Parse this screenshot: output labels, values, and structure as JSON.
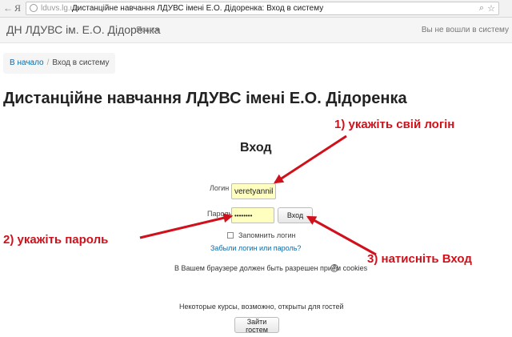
{
  "browser": {
    "back_glyph": "←",
    "yandex_logo": "Я",
    "host": "lduvs.lg.ua",
    "page_title": "Дистанційне навчання ЛДУВС імені Е.О. Дідоренка: Вход в систему",
    "search_icon": "⌕",
    "star_icon": "☆"
  },
  "navbar": {
    "brand": "ДН ЛДУВС ім. Е.О. Дідоренка",
    "language_menu": "Язык",
    "login_status": "Вы не вошли в систему"
  },
  "breadcrumb": {
    "home": "В начало",
    "separator": "/",
    "current": "Вход в систему"
  },
  "page": {
    "heading": "Дистанційне навчання ЛДУВС імені Е.О. Дідоренка"
  },
  "login_form": {
    "title": "Вход",
    "username_label": "Логин",
    "username_value": "veretyannikov",
    "password_label": "Пароль",
    "password_value": "••••••••",
    "submit_label": "Вход",
    "remember_label": "Запомнить логин",
    "forgot_link": "Забыли логин или пароль?",
    "cookies_note": "В Вашем браузере должен быть разрешен прием cookies",
    "help_icon": "?"
  },
  "guest": {
    "note": "Некоторые курсы, возможно, открыты для гостей",
    "button_label": "Зайти гостем"
  },
  "annotations": {
    "step1": "1) укажіть свій логін",
    "step2": "2) укажіть пароль",
    "step3": "3) натисніть Вход",
    "color": "#d0111b"
  }
}
